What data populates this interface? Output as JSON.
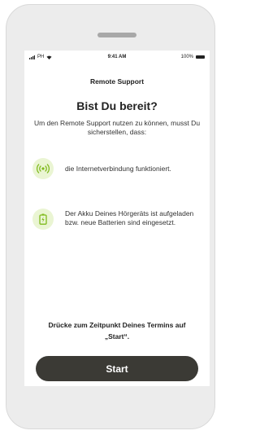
{
  "status_bar": {
    "carrier": "PH",
    "time": "9:41 AM",
    "battery": "100%"
  },
  "nav": {
    "title": "Remote Support"
  },
  "heading": "Bist Du bereit?",
  "intro": "Um den Remote Support nutzen zu können, musst Du sicherstellen, dass:",
  "checklist": [
    {
      "icon": "wireless-signal-icon",
      "text": "die Internetverbindung funktioniert."
    },
    {
      "icon": "battery-charging-icon",
      "text": "Der Akku Deines Hörgeräts ist aufgeladen bzw. neue Batterien sind eingesetzt."
    }
  ],
  "footer_note": "Drücke zum Zeitpunkt Deines Termins auf „Start“.",
  "start_button": "Start",
  "colors": {
    "accent_light": "#eaf5d3",
    "accent_icon": "#7fba1c",
    "button": "#3b3a35",
    "frame": "#ececec"
  }
}
